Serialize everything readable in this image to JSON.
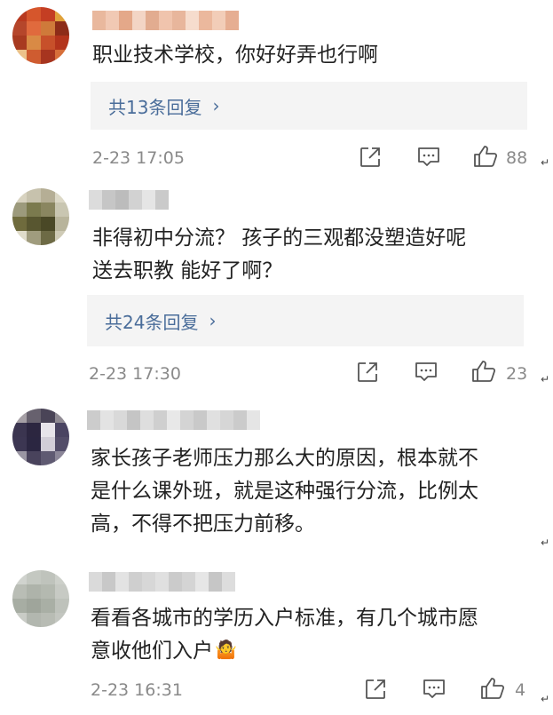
{
  "comments": [
    {
      "text": "职业技术学校，你好好弄也行啊",
      "replies_label": "共13条回复",
      "date": "2-23 17:05",
      "likes": "88",
      "avatar_colors": [
        "#b8391f",
        "#d6562c",
        "#c43e23",
        "#e0a23b",
        "#b5462b",
        "#e06a3d",
        "#cf7a3a",
        "#8d2c18",
        "#a83a20",
        "#d98a45",
        "#c7502a",
        "#b3341c",
        "#ecc28a",
        "#cf5c30",
        "#a7351f",
        "#d76f3a"
      ],
      "username_colors": [
        "#e9b89d",
        "#f1c9b4",
        "#e4a889",
        "#f3d5c5",
        "#e2ac90",
        "#f0c4ad",
        "#e8b69c",
        "#f6dccd",
        "#ebb89d",
        "#f2cdb8",
        "#e6ae92"
      ]
    },
    {
      "text_lines": [
        "非得初中分流？ 孩子的三观都没塑造好呢",
        "送去职教 能好了啊？"
      ],
      "replies_label": "共24条回复",
      "date": "2-23 17:30",
      "likes": "23",
      "avatar_colors": [
        "#d8d3c0",
        "#c7c2ad",
        "#b5ae95",
        "#dcd8c6",
        "#9c9a7c",
        "#7b7a4e",
        "#8a8660",
        "#c9c6b1",
        "#6f6b3d",
        "#585630",
        "#4a4826",
        "#b8b49b",
        "#e0dccb",
        "#a09c7e",
        "#6d6a45",
        "#cfcbb6"
      ],
      "username_colors": [
        "#dcdcdc",
        "#c6c6c6",
        "#bcbcbc",
        "#d2d2d2",
        "#e5e5e5",
        "#cacaca"
      ]
    },
    {
      "text_lines": [
        "家长孩子老师压力那么大的原因，根本就不",
        "是什么课外班，就是这种强行分流，比例太",
        "高，不得不把压力前移。"
      ],
      "avatar_colors": [
        "#a6a0a6",
        "#67616e",
        "#4a4457",
        "#8f8a93",
        "#3b3550",
        "#2c2640",
        "#e7e4ea",
        "#4a4462",
        "#3c3652",
        "#2b2641",
        "#d2ced8",
        "#534d69",
        "#9a96a3",
        "#49435c",
        "#5f5a72",
        "#8b8698"
      ],
      "username_colors": [
        "#cccccc",
        "#e3e3e3",
        "#d9d9d9",
        "#c5c5c5",
        "#dedede",
        "#cfcfcf",
        "#e8e8e8",
        "#d4d4d4",
        "#c9c9c9",
        "#e0e0e0",
        "#d6d6d6",
        "#cbcbcb",
        "#e5e5e5"
      ]
    },
    {
      "text_lines": [
        "看看各城市的学历入户标准，有几个城市愿",
        "意收他们入户"
      ],
      "emoji": "🤷",
      "date": "2-23 16:31",
      "likes": "4",
      "avatar_colors": [
        "#d0d3ce",
        "#c4c8c1",
        "#bfc3bc",
        "#cdd0ca",
        "#b9bdb5",
        "#aeb3aa",
        "#b4b9b0",
        "#c7cac4",
        "#a7ada3",
        "#9fa59b",
        "#a9afa5",
        "#bec2bb",
        "#c9ccc6",
        "#b2b7af",
        "#b8bcb4",
        "#c3c6c0"
      ],
      "username_colors": [
        "#dadada",
        "#c8c8c8",
        "#e3e3e3",
        "#cfcfcf",
        "#d7d7d7",
        "#e0e0e0",
        "#cbcbcb",
        "#d4d4d4",
        "#e6e6e6",
        "#c6c6c6",
        "#ddd"
      ]
    }
  ],
  "return_mark": "↵",
  "reply_chevron": "›",
  "icons": {
    "share": "share-icon",
    "comment": "comment-icon",
    "like": "thumbs-up-icon"
  }
}
